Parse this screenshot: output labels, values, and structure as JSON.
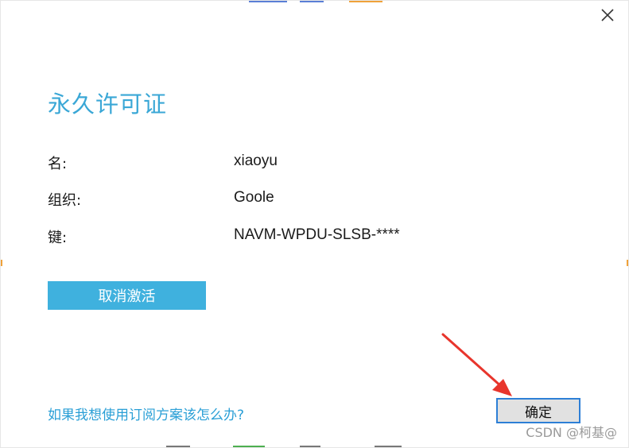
{
  "dialog": {
    "title": "永久许可证",
    "close_icon": "close-icon"
  },
  "license": {
    "name_label": "名:",
    "name_value": "xiaoyu",
    "org_label": "组织:",
    "org_value": "Goole",
    "key_label": "键:",
    "key_value": "NAVM-WPDU-SLSB-****"
  },
  "actions": {
    "deactivate_label": "取消激活",
    "subscribe_link": "如果我想使用订阅方案该怎么办?",
    "ok_label": "确定"
  },
  "watermark": "CSDN @柯基@",
  "colors": {
    "accent": "#3aa7d6",
    "button_blue": "#3fb1de",
    "ok_border": "#2d7fd6",
    "annotation_arrow": "#e8352c"
  }
}
